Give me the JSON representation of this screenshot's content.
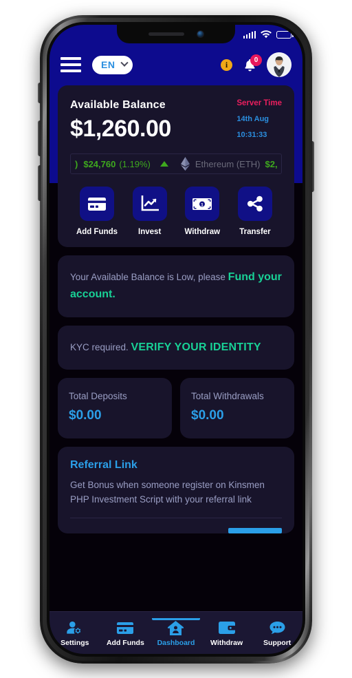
{
  "statusbar": {
    "signal_icon": "signal-bars-icon",
    "wifi_icon": "wifi-icon",
    "battery_icon": "battery-icon"
  },
  "header": {
    "menu_icon": "hamburger-menu-icon",
    "language": "EN",
    "language_chevron_icon": "chevron-down-icon",
    "info_icon_label": "i",
    "bell_icon": "bell-icon",
    "notification_count": "0",
    "avatar_icon": "user-avatar",
    "bg_color": "#0d0b8e"
  },
  "balance": {
    "label": "Available Balance",
    "amount": "$1,260.00",
    "server_time_label": "Server Time",
    "server_date": "14th Aug",
    "server_clock": "10:31:33",
    "server_label_color": "#ea1f5e",
    "server_value_color": "#2b8fe0"
  },
  "ticker": {
    "btc_clip": ")",
    "btc_price": "$24,760",
    "btc_change": "(1.19%)",
    "direction_icon": "triangle-up-icon",
    "eth_icon": "ethereum-icon",
    "eth_name": "Ethereum (ETH)",
    "eth_price": "$2,",
    "up_color": "#3ea81e"
  },
  "actions": [
    {
      "label": "Add Funds",
      "icon": "credit-card-icon"
    },
    {
      "label": "Invest",
      "icon": "chart-line-icon"
    },
    {
      "label": "Withdraw",
      "icon": "banknote-icon"
    },
    {
      "label": "Transfer",
      "icon": "share-icon"
    }
  ],
  "notice": {
    "text": "Your Available Balance is Low, please ",
    "link": "Fund your account.",
    "link_color": "#18d196"
  },
  "kyc": {
    "text": "KYC required. ",
    "link": "VERIFY YOUR IDENTITY",
    "link_color": "#18d196"
  },
  "stats": [
    {
      "label": "Total Deposits",
      "value": "$0.00"
    },
    {
      "label": "Total Withdrawals",
      "value": "$0.00"
    }
  ],
  "referral": {
    "title": "Referral Link",
    "description": "Get Bonus when someone register on Kinsmen PHP Investment Script with your referral link",
    "accent_color": "#2b9fe8"
  },
  "nav": [
    {
      "label": "Settings",
      "icon": "user-settings-icon",
      "active": false
    },
    {
      "label": "Add Funds",
      "icon": "credit-card-icon",
      "active": false
    },
    {
      "label": "Dashboard",
      "icon": "home-icon",
      "active": true
    },
    {
      "label": "Withdraw",
      "icon": "wallet-icon",
      "active": false
    },
    {
      "label": "Support",
      "icon": "chat-bubble-icon",
      "active": false
    }
  ]
}
